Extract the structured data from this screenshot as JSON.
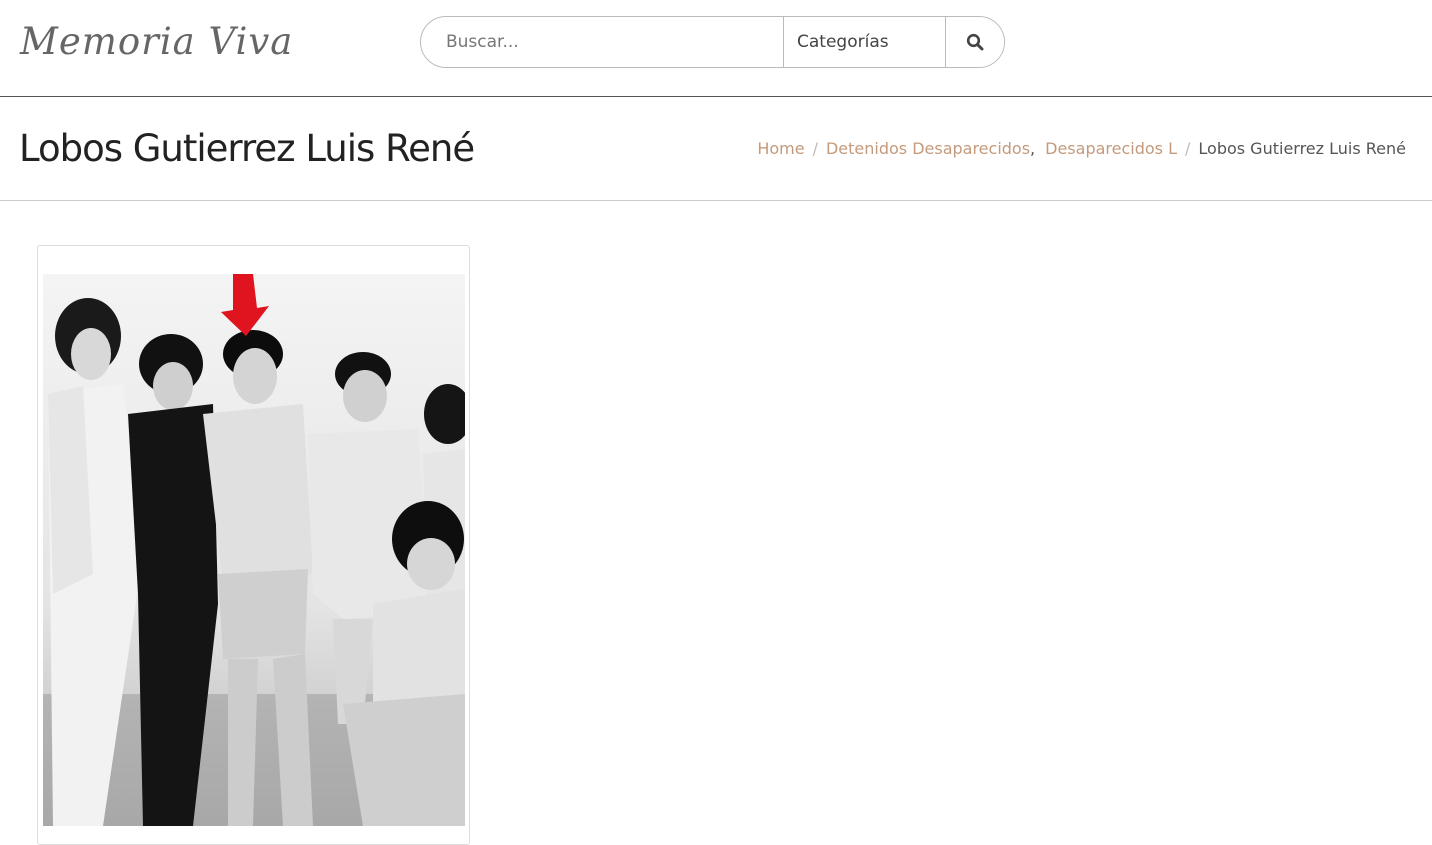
{
  "header": {
    "logo_text": "Memoria Viva",
    "search": {
      "placeholder": "Buscar...",
      "value": ""
    },
    "category_label": "Categorías",
    "search_button_icon": "search-icon"
  },
  "page": {
    "title": "Lobos Gutierrez Luis René"
  },
  "breadcrumb": {
    "home": "Home",
    "category_1": "Detenidos Desaparecidos",
    "category_2": "Desaparecidos L",
    "current": "Lobos Gutierrez Luis René"
  },
  "photo": {
    "description_icon": "photo-icon"
  },
  "colors": {
    "link": "#c49a7c",
    "arrow": "#e0141e",
    "header_border": "#555555"
  }
}
